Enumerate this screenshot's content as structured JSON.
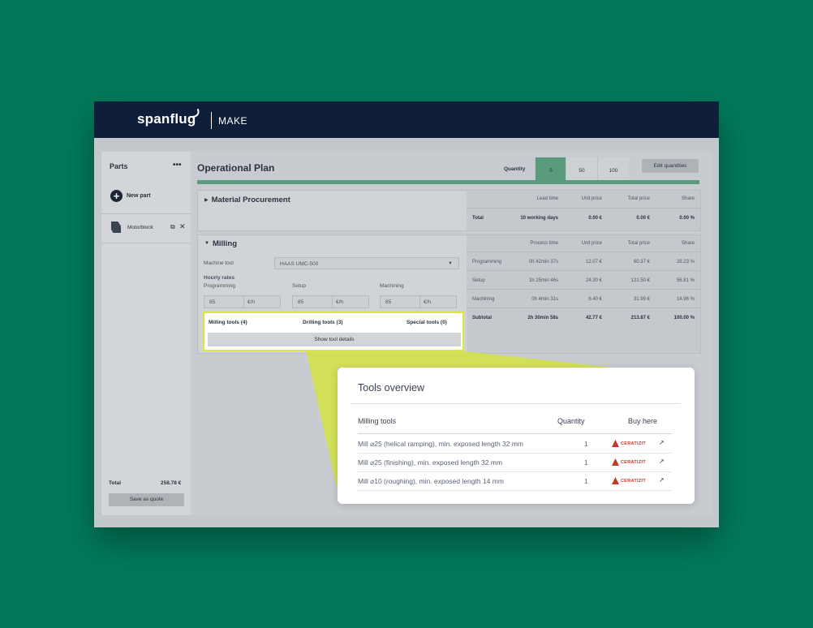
{
  "header": {
    "logo": "spanflug",
    "product": "MAKE"
  },
  "sidebar": {
    "title": "Parts",
    "more": "•••",
    "new_part": "New part",
    "parts": [
      {
        "name": "Motorblock"
      }
    ],
    "total_label": "Total",
    "total_value": "258.78 €",
    "save_quote": "Save as quote"
  },
  "main": {
    "title": "Operational Plan",
    "quantity_label": "Quantity",
    "quantities": [
      "5",
      "50",
      "100"
    ],
    "selected_quantity": "5",
    "edit_quantities": "Edit quantities",
    "procurement": {
      "title": "Material Procurement",
      "headers": [
        "Lead time",
        "Unit price",
        "Total price",
        "Share"
      ],
      "total": {
        "label": "Total",
        "lead_time": "10 working days",
        "unit_price": "0.00 €",
        "total_price": "0.00 €",
        "share": "0.00 %"
      }
    },
    "milling": {
      "title": "Milling",
      "machine_tool_label": "Machine tool",
      "machine_tool_value": "HAAS UMC-500",
      "hourly_rates_label": "Hourly rates",
      "rates": [
        {
          "label": "Programming",
          "value": "85",
          "unit": "€/h"
        },
        {
          "label": "Setup",
          "value": "85",
          "unit": "€/h"
        },
        {
          "label": "Machining",
          "value": "85",
          "unit": "€/h"
        }
      ],
      "tools": {
        "milling": "Milling tools (4)",
        "drilling": "Drilling tools (3)",
        "special": "Special tools (0)",
        "show_details": "Show tool details"
      },
      "headers": [
        "Process time",
        "Unit price",
        "Total price",
        "Share"
      ],
      "rows": [
        {
          "label": "Programming",
          "time": "0h 42min 37s",
          "unit": "12.07 €",
          "total": "60.37 €",
          "share": "28.23 %"
        },
        {
          "label": "Setup",
          "time": "1h 25min 46s",
          "unit": "24.30 €",
          "total": "121.50 €",
          "share": "56.81 %"
        },
        {
          "label": "Machining",
          "time": "0h 4min 31s",
          "unit": "6.40 €",
          "total": "31.99 €",
          "share": "14.96 %"
        }
      ],
      "subtotal": {
        "label": "Subtotal",
        "time": "2h 30min 58s",
        "unit": "42.77 €",
        "total": "213.87 €",
        "share": "100.00 %"
      }
    }
  },
  "tools_overview": {
    "title": "Tools overview",
    "headers": [
      "Milling tools",
      "Quantity",
      "Buy here"
    ],
    "rows": [
      {
        "name": "Mill ⌀25 (helical ramping), min. exposed length 32 mm",
        "qty": "1",
        "vendor": "CERATIZIT"
      },
      {
        "name": "Mill ⌀25 (finishing), min. exposed length 32 mm",
        "qty": "1",
        "vendor": "CERATIZIT"
      },
      {
        "name": "Mill ⌀10 (roughing), min. exposed length 14 mm",
        "qty": "1",
        "vendor": "CERATIZIT"
      }
    ]
  }
}
